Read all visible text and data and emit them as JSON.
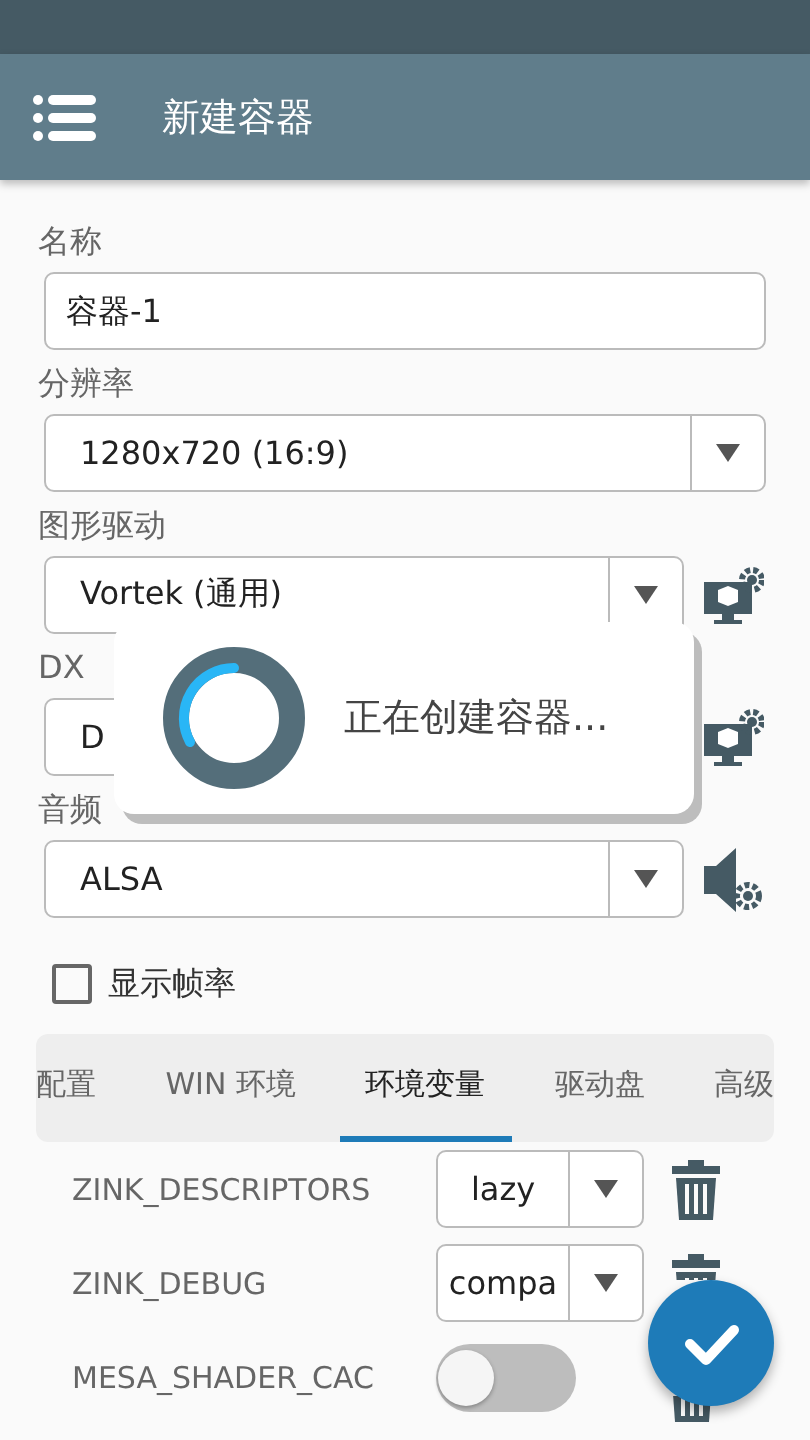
{
  "toolbar": {
    "title": "新建容器"
  },
  "fields": [
    {
      "kind": "text",
      "label": "名称",
      "value": "容器-1"
    },
    {
      "kind": "select",
      "label": "分辨率",
      "value": "1280x720 (16:9)"
    },
    {
      "kind": "display",
      "label": "图形驱动",
      "value": "Vortek (通用)"
    },
    {
      "kind": "display",
      "label": "DX",
      "value": "D"
    },
    {
      "kind": "audio",
      "label": "音频",
      "value": "ALSA"
    }
  ],
  "show_fps": {
    "label": "显示帧率",
    "checked": false
  },
  "tabs": [
    {
      "label": "配置",
      "selected": false
    },
    {
      "label": "WIN 环境",
      "selected": false
    },
    {
      "label": "环境变量",
      "selected": true
    },
    {
      "label": "驱动盘",
      "selected": false
    },
    {
      "label": "高级",
      "selected": false
    }
  ],
  "env_vars": [
    {
      "kind": "select",
      "name": "ZINK_DESCRIPTORS",
      "value": "lazy"
    },
    {
      "kind": "select",
      "name": "ZINK_DEBUG",
      "value": "compa"
    },
    {
      "kind": "toggle",
      "name": "MESA_SHADER_CAC",
      "on": false
    }
  ],
  "dialog": {
    "message": "正在创建容器..."
  }
}
